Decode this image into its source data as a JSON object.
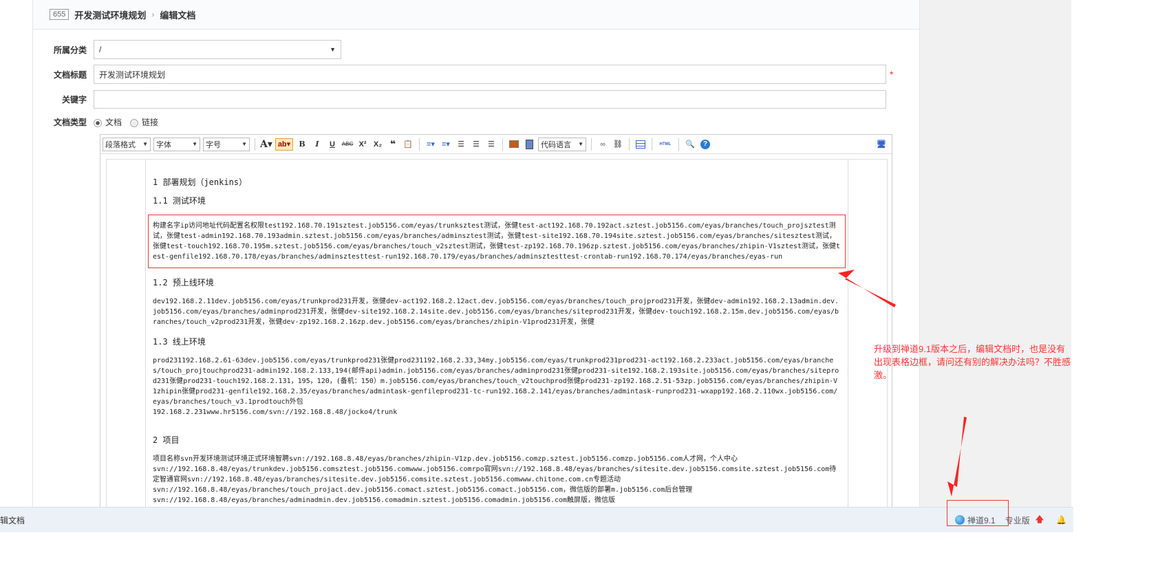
{
  "header": {
    "doc_id": "655",
    "crumb_doc": "开发测试环境规划",
    "crumb_sep": "›",
    "crumb_action": "编辑文档"
  },
  "form": {
    "category": {
      "label": "所属分类",
      "value": "/"
    },
    "title": {
      "label": "文档标题",
      "value": "开发测试环境规划",
      "required": "*"
    },
    "keywords": {
      "label": "关键字",
      "value": ""
    },
    "type": {
      "label": "文档类型",
      "options": [
        "文档",
        "链接"
      ],
      "selected": "文档"
    }
  },
  "toolbar": {
    "paragraph": "段落格式",
    "font": "字体",
    "size": "字号",
    "code_lang": "代码语言",
    "bold": "B",
    "italic": "I",
    "underline": "U",
    "strike": "ABC",
    "sup": "X²",
    "sub": "X₂",
    "quote": "❝",
    "html": "HTML",
    "help": "?"
  },
  "doc": {
    "h1": "1 部署规划（jenkins）",
    "h11": "1.1 测试环境",
    "p11": "构建名字ip访问地址代码配置名权限test192.168.70.191sztest.job5156.com/eyas/trunksztest测试，张健test-act192.168.70.192act.sztest.job5156.com/eyas/branches/touch_projsztest测试，张健test-admin192.168.70.193admin.sztest.job5156.com/eyas/branches/adminsztest测试，张健test-site192.168.70.194site.sztest.job5156.com/eyas/branches/sitesztest测试，张健test-touch192.168.70.195m.sztest.job5156.com/eyas/branches/touch_v2sztest测试，张健test-zp192.168.70.196zp.sztest.job5156.com/eyas/branches/zhipin-V1sztest测试，张健test-genfile192.168.70.178/eyas/branches/adminsztesttest-run192.168.70.179/eyas/branches/adminsztesttest-crontab-run192.168.70.174/eyas/branches/eyas-run",
    "h12": "1.2 预上线环境",
    "p12": "dev192.168.2.11dev.job5156.com/eyas/trunkprod231开发，张健dev-act192.168.2.12act.dev.job5156.com/eyas/branches/touch_projprod231开发，张健dev-admin192.168.2.13admin.dev.job5156.com/eyas/branches/adminprod231开发，张健dev-site192.168.2.14site.dev.job5156.com/eyas/branches/siteprod231开发，张健dev-touch192.168.2.15m.dev.job5156.com/eyas/branches/touch_v2prod231开发，张健dev-zp192.168.2.16zp.dev.job5156.com/eyas/branches/zhipin-V1prod231开发，张健",
    "h13": "1.3 线上环境",
    "p13": "prod231192.168.2.61-63dev.job5156.com/eyas/trunkprod231张健prod231192.168.2.33,34my.job5156.com/eyas/trunkprod231prod231-act192.168.2.233act.job5156.com/eyas/branches/touch_projtouchprod231-admin192.168.2.133,194(邮件api)admin.job5156.com/eyas/branches/adminprod231张健prod231-site192.168.2.193site.job5156.com/eyas/branches/siteprod231张健prod231-touch192.168.2.131，195，120，(备机：150）m.job5156.com/eyas/branches/touch_v2touchprod张健prod231-zp192.168.2.51-53zp.job5156.com/eyas/branches/zhipin-V1zhipin张健prod231-genfile192.168.2.35/eyas/branches/admintask-genfileprod231-tc-run192.168.2.141/eyas/branches/admintask-runprod231-wxapp192.168.2.110wx.job5156.com/eyas/branches/touch_v3.1prodtouch外包\n192.168.2.231www.hr5156.com/svn://192.168.8.48/jocko4/trunk",
    "h2": "2 项目",
    "p2": "项目名称svn开发环境测试环境正式环境智聘svn://192.168.8.48/eyas/branches/zhipin-V1zp.dev.job5156.comzp.sztest.job5156.comzp.job5156.com人才网，个人中心\nsvn://192.168.8.48/eyas/trunkdev.job5156.comsztest.job5156.comwww.job5156.comrpo官网svn://192.168.8.48/eyas/branches/sitesite.dev.job5156.comsite.sztest.job5156.com待定智通官网svn://192.168.8.48/eyas/branches/sitesite.dev.job5156.comsite.sztest.job5156.comwww.chitone.com.cn专题活动\nsvn://192.168.8.48/eyas/branches/touch_projact.dev.job5156.comact.sztest.job5156.comact.job5156.com，微信版的部署m.job5156.com后台管理\nsvn://192.168.8.48/eyas/branches/adminadmin.dev.job5156.comadmin.sztest.job5156.comadmin.job5156.com触屏版，微信版"
  },
  "bottom": {
    "left_label": "辑文档",
    "version": "禅道9.1",
    "edition": "专业版"
  },
  "annotation": {
    "text": "升级到禅道9.1版本之后，编辑文档时，也是没有出现表格边框，请问还有别的解决办法吗？不胜感激。",
    "color": "#ff3333"
  }
}
